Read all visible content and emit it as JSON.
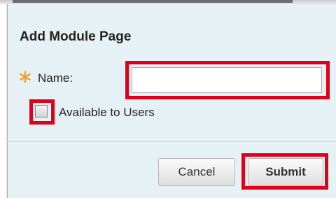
{
  "dialog": {
    "title": "Add Module Page",
    "name_label": "Name:",
    "name_value": "",
    "name_placeholder": "",
    "available_label": "Available to Users",
    "available_checked": false,
    "cancel_label": "Cancel",
    "submit_label": "Submit"
  },
  "icons": {
    "required": "asterisk-icon"
  },
  "colors": {
    "panel_background": "#e6f1f5",
    "required_star": "#f0a020",
    "highlight": "#e0001b"
  }
}
